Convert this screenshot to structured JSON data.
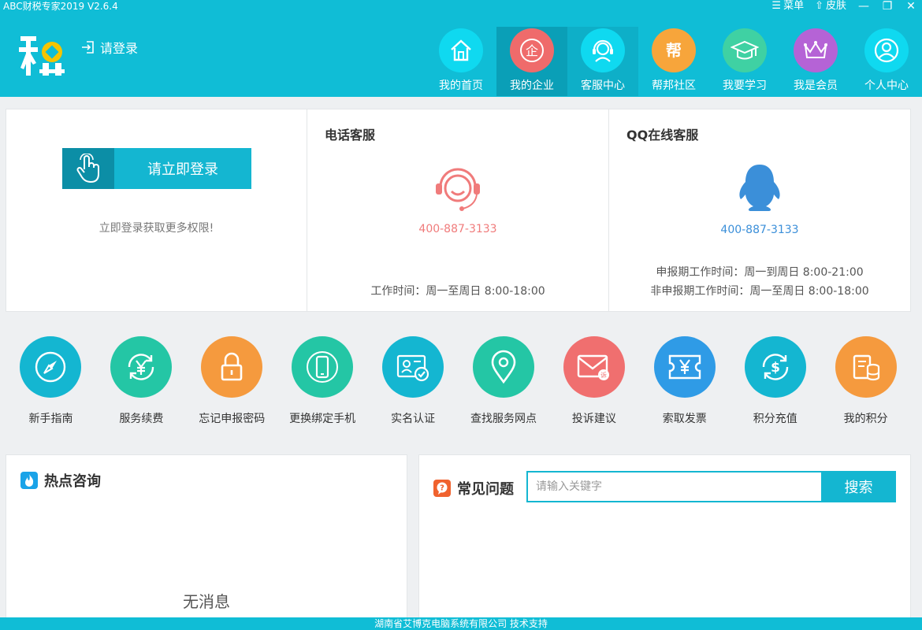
{
  "app": {
    "title": "ABC财税专家2019 V2.6.4"
  },
  "window": {
    "menu_label": "菜单",
    "skin_label": "皮肤"
  },
  "header": {
    "login_label": "请登录"
  },
  "nav": [
    {
      "label": "我的首页",
      "icon": "home-icon",
      "color": "#0fd9f0"
    },
    {
      "label": "我的企业",
      "icon": "enterprise-icon",
      "color": "#ef6b6b"
    },
    {
      "label": "客服中心",
      "icon": "headset-icon",
      "color": "#0fd9f0"
    },
    {
      "label": "帮邦社区",
      "icon": "community-icon",
      "color": "#f7a53b"
    },
    {
      "label": "我要学习",
      "icon": "graduation-cap-icon",
      "color": "#3fd1a3"
    },
    {
      "label": "我是会员",
      "icon": "crown-icon",
      "color": "#b563d6"
    },
    {
      "label": "个人中心",
      "icon": "user-icon",
      "color": "#0fd9f0"
    }
  ],
  "nav_enterprise_char": "企",
  "nav_community_char": "帮",
  "login_panel": {
    "button_label": "请立即登录",
    "hint": "立即登录获取更多权限!"
  },
  "phone_panel": {
    "title": "电话客服",
    "number": "400-887-3133",
    "work_time": "工作时间：周一至周日 8:00-18:00"
  },
  "qq_panel": {
    "title": "QQ在线客服",
    "number": "400-887-3133",
    "work_time_filing": "申报期工作时间：周一到周日 8:00-21:00",
    "work_time_nonfiling": "非申报期工作时间：周一至周日 8:00-18:00"
  },
  "quick_functions": [
    {
      "label": "新手指南",
      "icon": "compass-icon",
      "color": "#14b6d1"
    },
    {
      "label": "服务续费",
      "icon": "yuan-renew-icon",
      "color": "#24c6a5"
    },
    {
      "label": "忘记申报密码",
      "icon": "lock-icon",
      "color": "#f59a3e"
    },
    {
      "label": "更换绑定手机",
      "icon": "phone-icon",
      "color": "#24c6a5"
    },
    {
      "label": "实名认证",
      "icon": "id-card-icon",
      "color": "#14b6d1"
    },
    {
      "label": "查找服务网点",
      "icon": "location-pin-icon",
      "color": "#24c6a5"
    },
    {
      "label": "投诉建议",
      "icon": "mail-icon",
      "color": "#f06f6f"
    },
    {
      "label": "索取发票",
      "icon": "invoice-icon",
      "color": "#2f9be6"
    },
    {
      "label": "积分充值",
      "icon": "dollar-recharge-icon",
      "color": "#14b6d1"
    },
    {
      "label": "我的积分",
      "icon": "coins-icon",
      "color": "#f59a3e"
    }
  ],
  "complaint_badge": "诉",
  "hot_panel": {
    "title": "热点咨询",
    "empty": "无消息"
  },
  "faq_panel": {
    "title": "常见问题",
    "search_placeholder": "请输入关键字",
    "search_button": "搜索"
  },
  "footer": {
    "text": "湖南省艾博克电脑系统有限公司 技术支持"
  },
  "brand": {
    "primary": "#10bdd6",
    "dark": "#0a9fb7"
  }
}
